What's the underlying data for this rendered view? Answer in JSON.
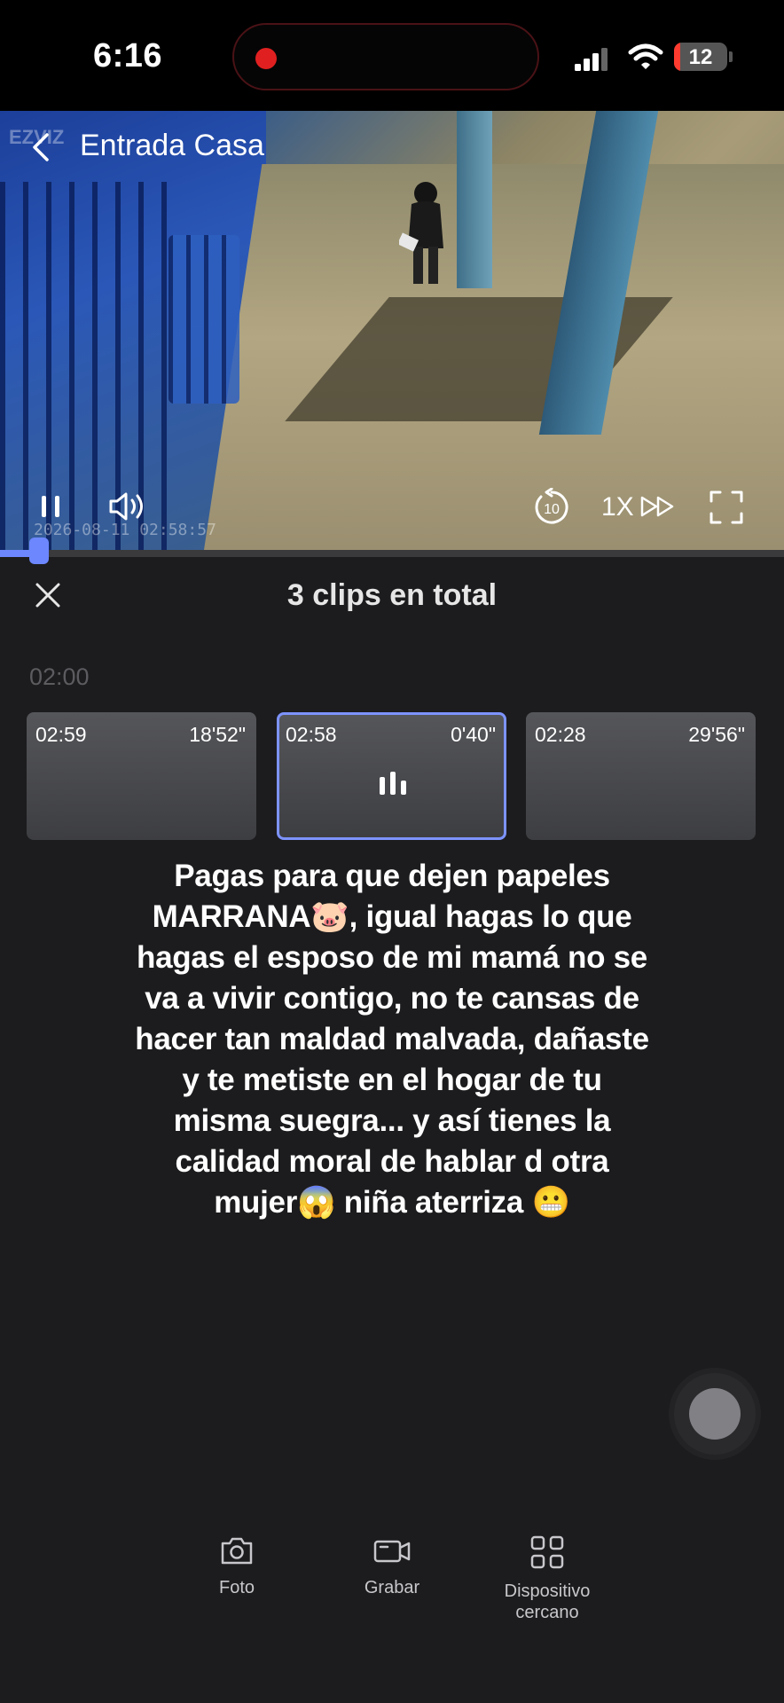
{
  "status_bar": {
    "time": "6:16",
    "battery": "12"
  },
  "player": {
    "title": "Entrada Casa",
    "watermark": "EZVIZ",
    "timestamp": "2026-08-11 02:58:57",
    "speed": "1X",
    "skip_back_seconds": "10",
    "progress": 0.05
  },
  "panel": {
    "title": "3 clips en total",
    "time_group": "02:00",
    "clips": [
      {
        "time": "02:59",
        "duration": "18'52\"",
        "active": false
      },
      {
        "time": "02:58",
        "duration": "0'40\"",
        "active": true
      },
      {
        "time": "02:28",
        "duration": "29'56\"",
        "active": false
      }
    ]
  },
  "overlay_text": "Pagas para que dejen papeles MARRANA🐷, igual hagas lo que hagas el esposo de mi mamá no se va a vivir contigo, no te cansas de hacer tan maldad malvada, dañaste y te metiste en el hogar de tu misma suegra... y así tienes la calidad moral de hablar d otra mujer😱 niña aterriza 😬",
  "toolbar": {
    "photo_label": "Foto",
    "record_label": "Grabar",
    "nearby_label": "Dispositivo cercano"
  },
  "colors": {
    "accent": "#6d87ff",
    "background": "#1c1c1e"
  }
}
